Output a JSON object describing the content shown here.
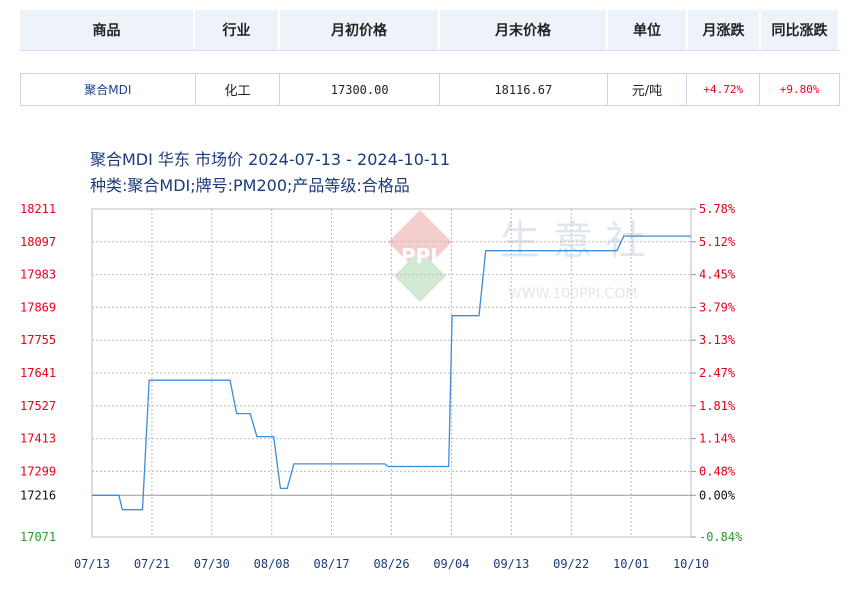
{
  "table": {
    "headers": [
      "商品",
      "行业",
      "月初价格",
      "月末价格",
      "单位",
      "月涨跌",
      "同比涨跌"
    ],
    "row": {
      "product": "聚合MDI",
      "industry": "化工",
      "start_price": "17300.00",
      "end_price": "18116.67",
      "unit": "元/吨",
      "month_change": "+4.72%",
      "yoy_change": "+9.80%"
    }
  },
  "watermark": {
    "brand": "生 意 社",
    "logo_text": "PPI",
    "url": "WWW.100PPI.COM"
  },
  "chart_data": {
    "type": "line",
    "title": "聚合MDI 华东 市场价 2024-07-13 - 2024-10-11",
    "subtitle": "种类:聚合MDI;牌号:PM200;产品等级:合格品",
    "x_tick_labels": [
      "07/13",
      "07/21",
      "07/30",
      "08/08",
      "08/17",
      "08/26",
      "09/04",
      "09/13",
      "09/22",
      "10/01",
      "10/10"
    ],
    "y_left_ticks": [
      "18211",
      "18097",
      "17983",
      "17869",
      "17755",
      "17641",
      "17527",
      "17413",
      "17299",
      "17216",
      "17071"
    ],
    "y_right_ticks": [
      "5.78%",
      "5.12%",
      "4.45%",
      "3.79%",
      "3.13%",
      "2.47%",
      "1.81%",
      "1.14%",
      "0.48%",
      "0.00%",
      "-0.84%"
    ],
    "ylim": [
      17071,
      18211
    ],
    "baseline": 17216,
    "grid": true,
    "colors": {
      "line": "#3c8dde",
      "left_axis": "#e8001a",
      "baseline_label": "#111111",
      "bottom_label": "#2a9a2a",
      "grid": "#bcbcbc"
    },
    "series": [
      {
        "values": [
          [
            0,
            17216
          ],
          [
            4,
            17216
          ],
          [
            4.5,
            17166
          ],
          [
            7.5,
            17166
          ],
          [
            8.5,
            17616
          ],
          [
            20.5,
            17616
          ],
          [
            21.5,
            17500
          ],
          [
            23.5,
            17500
          ],
          [
            24.5,
            17420
          ],
          [
            27,
            17420
          ],
          [
            28,
            17240
          ],
          [
            29,
            17240
          ],
          [
            30,
            17325
          ],
          [
            43.5,
            17325
          ],
          [
            44,
            17316
          ],
          [
            53,
            17316
          ],
          [
            53.5,
            17840
          ],
          [
            57.5,
            17840
          ],
          [
            58.5,
            18066
          ],
          [
            78,
            18066
          ],
          [
            79,
            18116.67
          ],
          [
            89,
            18116.67
          ]
        ]
      }
    ]
  }
}
